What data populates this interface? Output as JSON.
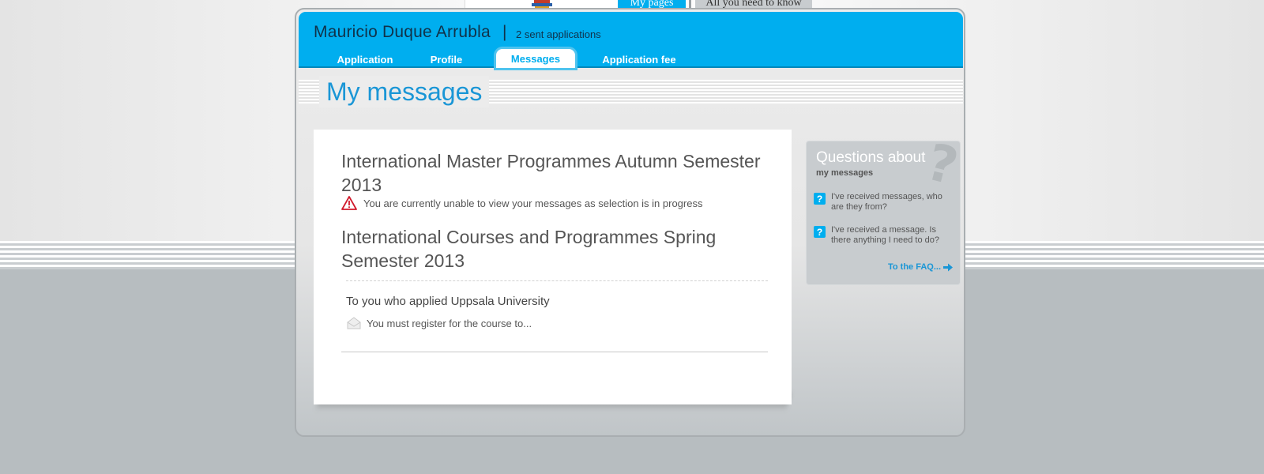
{
  "top_nav": {
    "my_pages": "My pages",
    "all_you_need": "All you need to know"
  },
  "header": {
    "user_name": "Mauricio Duque Arrubla",
    "separator": "|",
    "sent_applications": "2 sent applications"
  },
  "nav_tabs": [
    {
      "label": "Application"
    },
    {
      "label": "Profile"
    },
    {
      "label": "Messages",
      "active": true
    },
    {
      "label": "Application fee"
    }
  ],
  "page_title": "My messages",
  "sections": [
    {
      "title": "International Master Programmes Autumn Semester 2013",
      "notice": "You are currently unable to view your messages as selection is in progress"
    },
    {
      "title": "International Courses and Programmes Spring Semester 2013",
      "message_title": "To you who applied Uppsala University",
      "message_preview": "You must register for the course to..."
    }
  ],
  "faq": {
    "title": "Questions about",
    "subtitle": "my messages",
    "items": [
      {
        "text": "I've received messages, who are they from?"
      },
      {
        "text": "I've received a message. Is there anything I need to do?"
      }
    ],
    "link": "To the FAQ..."
  },
  "colors": {
    "brand_blue": "#00aeef",
    "title_blue": "#1a96d6",
    "warning_red": "#d0192b"
  },
  "icons": [
    "books-logo-icon",
    "warning-icon",
    "envelope-icon",
    "question-icon",
    "arrow-right-icon"
  ]
}
